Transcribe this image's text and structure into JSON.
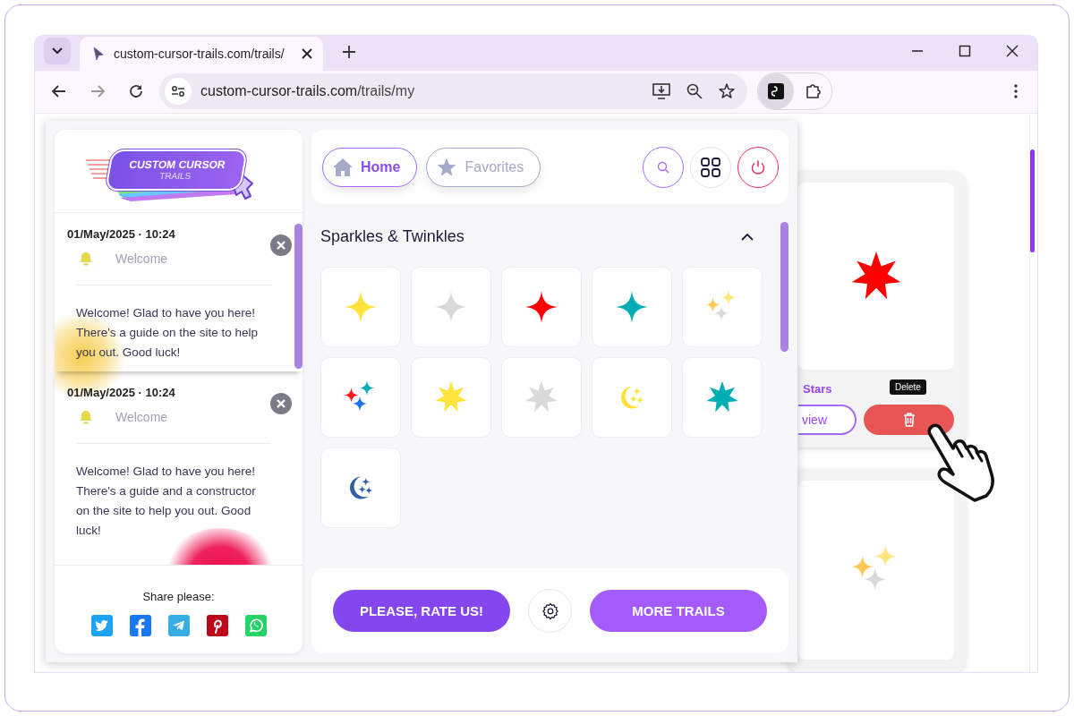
{
  "browser": {
    "tab_title": "custom-cursor-trails.com/trails/",
    "url_domain": "custom-cursor-trails.com",
    "url_path": "/trails/my"
  },
  "popup": {
    "logo": {
      "line1": "CUSTOM CURSOR",
      "line2": "TRAILS"
    },
    "notifications": [
      {
        "date": "01/May/2025 · 10:24",
        "title": "Welcome",
        "message": "Welcome! Glad to have you here! There's a guide on the site to help you out. Good luck!"
      },
      {
        "date": "01/May/2025 · 10:24",
        "title": "Welcome",
        "message": "Welcome! Glad to have you here! There's a guide and a constructor on the site to help you out. Good luck!"
      }
    ],
    "share": {
      "label": "Share please:",
      "networks": [
        {
          "kind": "twitter",
          "color": "#1da1f2"
        },
        {
          "kind": "facebook",
          "color": "#1877f2"
        },
        {
          "kind": "telegram",
          "color": "#37aee2"
        },
        {
          "kind": "pinterest",
          "color": "#bd081c"
        },
        {
          "kind": "whatsapp",
          "color": "#25d366"
        }
      ]
    },
    "nav": [
      {
        "label": "Home",
        "selected": true,
        "kind": "home"
      },
      {
        "label": "Favorites",
        "selected": false,
        "kind": "star"
      }
    ],
    "section": {
      "title": "Sparkles & Twinkles",
      "expanded": true,
      "trails": [
        {
          "kind": "sparkle",
          "color": "#ffe23b"
        },
        {
          "kind": "sparkle",
          "color": "#d9d9d9"
        },
        {
          "kind": "sparkle",
          "color": "#ff0000"
        },
        {
          "kind": "sparkle",
          "color": "#00adb5"
        },
        {
          "kind": "cluster",
          "sparkles": [
            {
              "color": "#ffc857"
            },
            {
              "color": "#ffe680"
            },
            {
              "color": "#d9d9d9"
            }
          ]
        },
        {
          "kind": "cluster",
          "sparkles": [
            {
              "color": "#ff1a1a"
            },
            {
              "color": "#00adb5"
            },
            {
              "color": "#1a73e8"
            }
          ]
        },
        {
          "kind": "star",
          "color": "#ffe23b"
        },
        {
          "kind": "star",
          "color": "#d9d9d9"
        },
        {
          "kind": "moon",
          "color": "#ffe23b"
        },
        {
          "kind": "star",
          "color": "#00adb5"
        },
        {
          "kind": "moon",
          "color": "#2e5fa8"
        }
      ]
    },
    "footer": {
      "rate_label": "PLEASE, RATE US!",
      "more_label": "MORE TRAILS"
    }
  },
  "page": {
    "cards": [
      {
        "kind": "star",
        "color": "#ff0000",
        "label": "Stars",
        "view_label": "view",
        "tooltip": "Delete"
      },
      {
        "kind": "cluster",
        "sparkles": [
          {
            "color": "#ffc857"
          },
          {
            "color": "#ffe680"
          },
          {
            "color": "#d9d9d9"
          }
        ]
      }
    ]
  }
}
